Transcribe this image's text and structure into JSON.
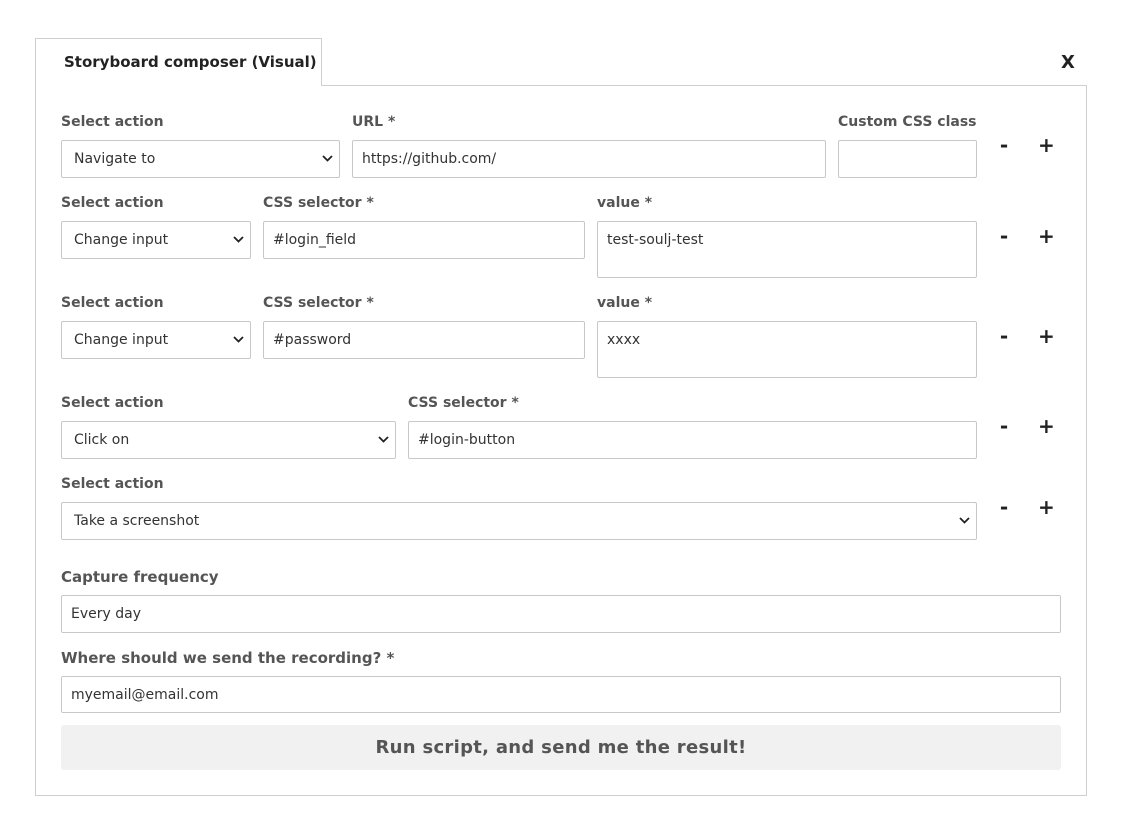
{
  "dialog": {
    "tab_title": "Storyboard composer (Visual)",
    "close_label": "X"
  },
  "rows": [
    {
      "action_label": "Select action",
      "action_value": "Navigate to",
      "field1_label": "URL *",
      "field1_value": "https://github.com/",
      "field2_label": "Custom CSS class",
      "field2_value": ""
    },
    {
      "action_label": "Select action",
      "action_value": "Change input",
      "field1_label": "CSS selector *",
      "field1_value": "#login_field",
      "field2_label": "value *",
      "field2_value": "test-soulj-test"
    },
    {
      "action_label": "Select action",
      "action_value": "Change input",
      "field1_label": "CSS selector *",
      "field1_value": "#password",
      "field2_label": "value *",
      "field2_value": "xxxx"
    },
    {
      "action_label": "Select action",
      "action_value": "Click on",
      "field1_label": "CSS selector *",
      "field1_value": "#login-button"
    },
    {
      "action_label": "Select action",
      "action_value": "Take a screenshot"
    }
  ],
  "row_controls": {
    "minus": "-",
    "plus": "+"
  },
  "capture": {
    "label": "Capture frequency",
    "value": "Every day"
  },
  "email": {
    "label": "Where should we send the recording? *",
    "value": "myemail@email.com"
  },
  "submit_label": "Run script, and send me the result!"
}
